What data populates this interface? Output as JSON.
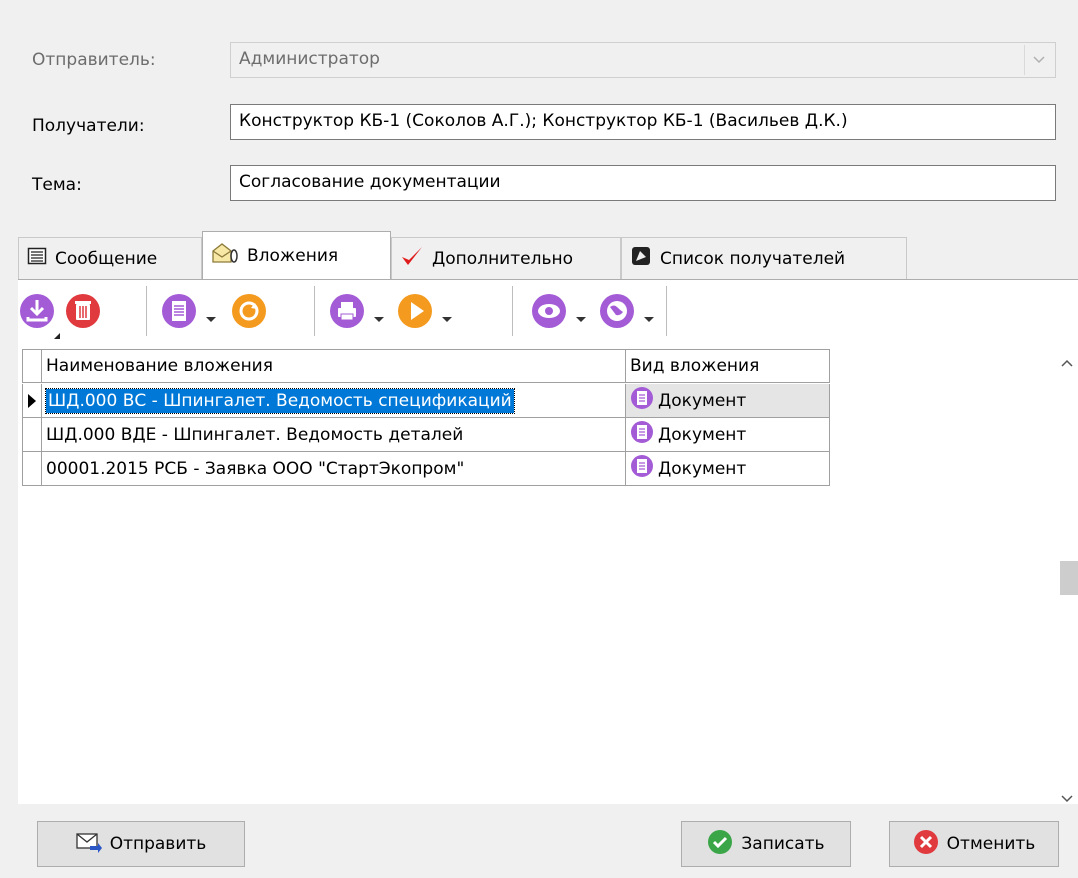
{
  "sender": {
    "label": "Отправитель:",
    "value": "Администратор"
  },
  "recipients": {
    "label": "Получатели:",
    "value": "Конструктор КБ-1 (Соколов А.Г.); Конструктор КБ-1 (Васильев Д.К.)"
  },
  "subject": {
    "label": "Тема:",
    "value": "Согласование документации"
  },
  "tabs": [
    {
      "label": "Сообщение",
      "icon": "message-icon"
    },
    {
      "label": "Вложения",
      "icon": "attachment-icon"
    },
    {
      "label": "Дополнительно",
      "icon": "checkmark-icon"
    },
    {
      "label": "Список получателей",
      "icon": "recipients-icon"
    }
  ],
  "active_tab": "Вложения",
  "grid": {
    "columns": [
      "Наименование вложения",
      "Вид вложения"
    ],
    "rows": [
      {
        "name": "ШД.000 ВС - Шпингалет. Ведомость спецификаций",
        "kind": "Документ",
        "selected": true
      },
      {
        "name": "ШД.000 ВДЕ - Шпингалет. Ведомость деталей",
        "kind": "Документ",
        "selected": false
      },
      {
        "name": "00001.2015 РСБ - Заявка ООО \"СтартЭкопром\"",
        "kind": "Документ",
        "selected": false
      }
    ]
  },
  "buttons": {
    "send": "Отправить",
    "save": "Записать",
    "cancel": "Отменить"
  },
  "colors": {
    "selection": "#0078d7",
    "toolbar_purple": "#a35bd6",
    "toolbar_orange": "#f39a1f",
    "delete_red": "#e0393e"
  }
}
